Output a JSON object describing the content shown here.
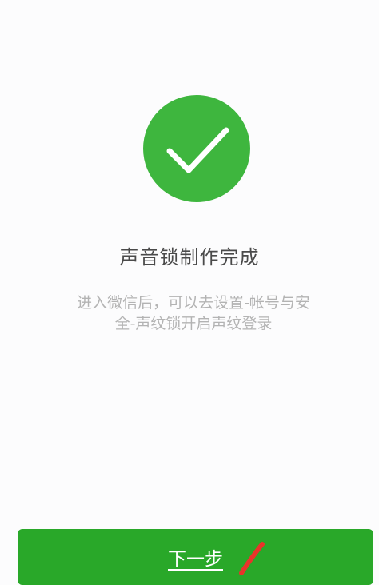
{
  "icons": {
    "success": "checkmark-icon",
    "annotation": "red-pen-mark"
  },
  "colors": {
    "success_green": "#3eb63e",
    "button_green": "#29a829",
    "title_text": "#4a4a4a",
    "desc_text": "#b3b3b3",
    "annotation_red": "#e8342a"
  },
  "main": {
    "title": "声音锁制作完成",
    "description_line1": "进入微信后，可以去设置-帐号与安",
    "description_line2": "全-声纹锁开启声纹登录"
  },
  "footer": {
    "next_label": "下一步"
  }
}
